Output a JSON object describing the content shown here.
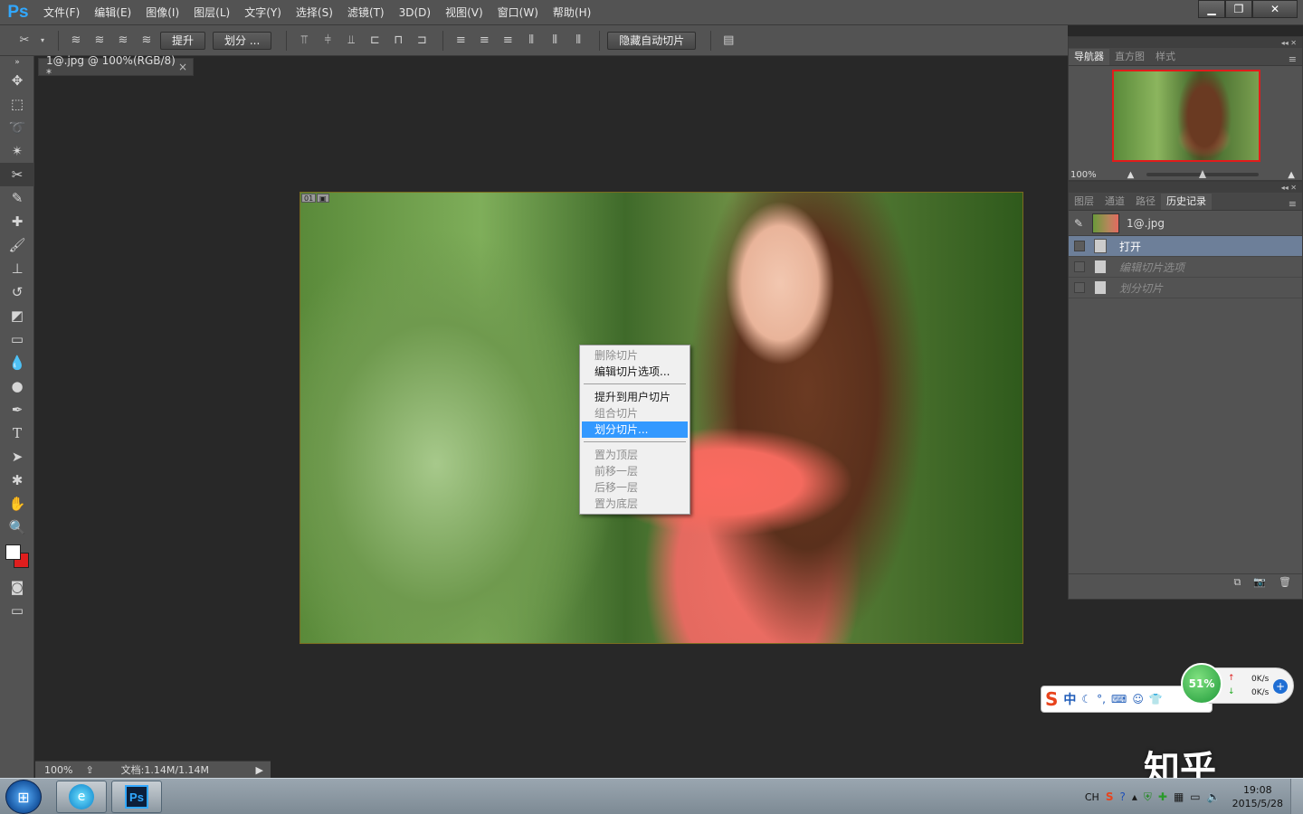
{
  "app": {
    "logo": "Ps",
    "menu": [
      "文件(F)",
      "编辑(E)",
      "图像(I)",
      "图层(L)",
      "文字(Y)",
      "选择(S)",
      "滤镜(T)",
      "3D(D)",
      "视图(V)",
      "窗口(W)",
      "帮助(H)"
    ],
    "window_controls": [
      "minimize-icon",
      "restore-icon",
      "close-icon"
    ]
  },
  "options_bar": {
    "promote_label": "提升",
    "divide_label": "划分 ...",
    "hide_auto_slices_label": "隐藏自动切片"
  },
  "document": {
    "tab_title": "1@.jpg @ 100%(RGB/8) *",
    "slice_number": "01",
    "zoom": "100%",
    "doc_size": "文档:1.14M/1.14M"
  },
  "context_menu": {
    "items": [
      {
        "label": "删除切片",
        "enabled": false
      },
      {
        "label": "编辑切片选项...",
        "enabled": true
      },
      {
        "label": "提升到用户切片",
        "enabled": true
      },
      {
        "label": "组合切片",
        "enabled": false
      },
      {
        "label": "划分切片...",
        "enabled": true,
        "highlighted": true
      },
      {
        "label": "置为顶层",
        "enabled": false
      },
      {
        "label": "前移一层",
        "enabled": false
      },
      {
        "label": "后移一层",
        "enabled": false
      },
      {
        "label": "置为底层",
        "enabled": false
      }
    ]
  },
  "navigator": {
    "tabs": [
      "导航器",
      "直方图",
      "样式"
    ],
    "zoom": "100%"
  },
  "history": {
    "tabs": [
      "图层",
      "通道",
      "路径",
      "历史记录"
    ],
    "snapshot_name": "1@.jpg",
    "states": [
      {
        "label": "打开",
        "selected": true
      },
      {
        "label": "编辑切片选项",
        "dimmed": true
      },
      {
        "label": "划分切片",
        "dimmed": true
      }
    ]
  },
  "ime": {
    "brand_glyph": "S",
    "mode": "中"
  },
  "net_widget": {
    "percent": "51%",
    "up_rate": "0K/s",
    "down_rate": "0K/s"
  },
  "watermark": "知乎",
  "taskbar": {
    "lang": "CH",
    "time": "19:08",
    "date": "2015/5/28"
  },
  "colors": {
    "ps_blue": "#31a8ff",
    "foreground": "#ffffff",
    "background": "#e01e1e",
    "menu_highlight": "#3399ff",
    "history_selected": "#6d7f99"
  }
}
